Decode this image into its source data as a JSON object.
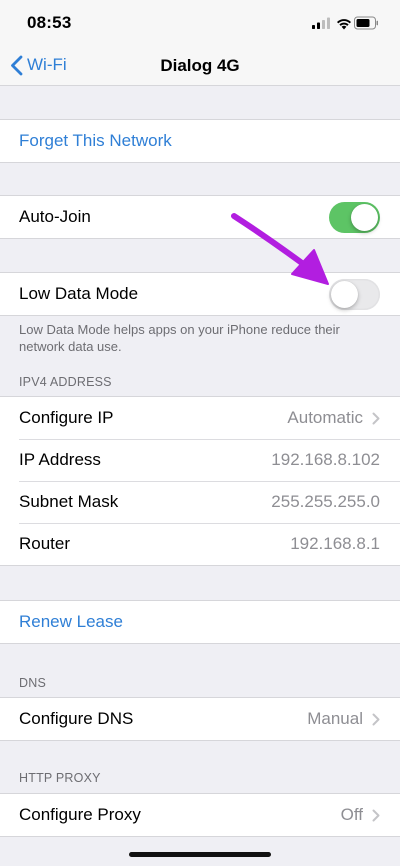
{
  "status_bar": {
    "time": "08:53"
  },
  "nav": {
    "back_label": "Wi-Fi",
    "title": "Dialog 4G"
  },
  "forget": {
    "label": "Forget This Network"
  },
  "auto_join": {
    "label": "Auto-Join",
    "enabled": true
  },
  "low_data": {
    "label": "Low Data Mode",
    "enabled": false,
    "note": "Low Data Mode helps apps on your iPhone reduce their network data use."
  },
  "ipv4": {
    "header": "IPV4 ADDRESS",
    "rows": [
      {
        "label": "Configure IP",
        "value": "Automatic"
      },
      {
        "label": "IP Address",
        "value": "192.168.8.102"
      },
      {
        "label": "Subnet Mask",
        "value": "255.255.255.0"
      },
      {
        "label": "Router",
        "value": "192.168.8.1"
      }
    ]
  },
  "renew": {
    "label": "Renew Lease"
  },
  "dns": {
    "header": "DNS",
    "label": "Configure DNS",
    "value": "Manual"
  },
  "proxy": {
    "header": "HTTP PROXY",
    "label": "Configure Proxy",
    "value": "Off"
  },
  "colors": {
    "accent": "#2f7fd6",
    "toggle_on": "#5dc465",
    "annotation_arrow": "#b21ee0"
  }
}
